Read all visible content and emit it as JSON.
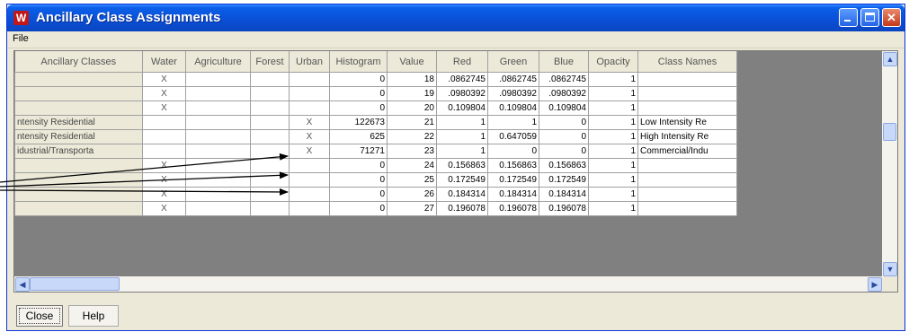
{
  "window": {
    "title": "Ancillary Class Assignments"
  },
  "menu": {
    "file": "File"
  },
  "grid": {
    "columns": [
      "Ancillary Classes",
      "Water",
      "Agriculture",
      "Forest",
      "Urban",
      "Histogram",
      "Value",
      "Red",
      "Green",
      "Blue",
      "Opacity",
      "Class Names"
    ],
    "rows": [
      {
        "ancillary": "",
        "water": "X",
        "agriculture": "",
        "forest": "",
        "urban": "",
        "histogram": "0",
        "value": "18",
        "red": ".0862745",
        "green": ".0862745",
        "blue": ".0862745",
        "opacity": "1",
        "class_name": ""
      },
      {
        "ancillary": "",
        "water": "X",
        "agriculture": "",
        "forest": "",
        "urban": "",
        "histogram": "0",
        "value": "19",
        "red": ".0980392",
        "green": ".0980392",
        "blue": ".0980392",
        "opacity": "1",
        "class_name": ""
      },
      {
        "ancillary": "",
        "water": "X",
        "agriculture": "",
        "forest": "",
        "urban": "",
        "histogram": "0",
        "value": "20",
        "red": "0.109804",
        "green": "0.109804",
        "blue": "0.109804",
        "opacity": "1",
        "class_name": ""
      },
      {
        "ancillary": "ntensity Residential",
        "water": "",
        "agriculture": "",
        "forest": "",
        "urban": "X",
        "histogram": "122673",
        "value": "21",
        "red": "1",
        "green": "1",
        "blue": "0",
        "opacity": "1",
        "class_name": "Low Intensity Re"
      },
      {
        "ancillary": "ntensity Residential",
        "water": "",
        "agriculture": "",
        "forest": "",
        "urban": "X",
        "histogram": "625",
        "value": "22",
        "red": "1",
        "green": "0.647059",
        "blue": "0",
        "opacity": "1",
        "class_name": "High Intensity Re"
      },
      {
        "ancillary": "idustrial/Transporta",
        "water": "",
        "agriculture": "",
        "forest": "",
        "urban": "X",
        "histogram": "71271",
        "value": "23",
        "red": "1",
        "green": "0",
        "blue": "0",
        "opacity": "1",
        "class_name": "Commercial/Indu"
      },
      {
        "ancillary": "",
        "water": "X",
        "agriculture": "",
        "forest": "",
        "urban": "",
        "histogram": "0",
        "value": "24",
        "red": "0.156863",
        "green": "0.156863",
        "blue": "0.156863",
        "opacity": "1",
        "class_name": ""
      },
      {
        "ancillary": "",
        "water": "X",
        "agriculture": "",
        "forest": "",
        "urban": "",
        "histogram": "0",
        "value": "25",
        "red": "0.172549",
        "green": "0.172549",
        "blue": "0.172549",
        "opacity": "1",
        "class_name": ""
      },
      {
        "ancillary": "",
        "water": "X",
        "agriculture": "",
        "forest": "",
        "urban": "",
        "histogram": "0",
        "value": "26",
        "red": "0.184314",
        "green": "0.184314",
        "blue": "0.184314",
        "opacity": "1",
        "class_name": ""
      },
      {
        "ancillary": "",
        "water": "X",
        "agriculture": "",
        "forest": "",
        "urban": "",
        "histogram": "0",
        "value": "27",
        "red": "0.196078",
        "green": "0.196078",
        "blue": "0.196078",
        "opacity": "1",
        "class_name": ""
      }
    ]
  },
  "buttons": {
    "close": "Close",
    "help": "Help"
  },
  "icons": {
    "app": "app-logo-icon",
    "minimize": "minimize-icon",
    "maximize": "maximize-icon",
    "close": "close-icon"
  },
  "colors": {
    "titlebar": "#0a4fd6",
    "close_button": "#c4391b",
    "grid_background": "#808080"
  }
}
